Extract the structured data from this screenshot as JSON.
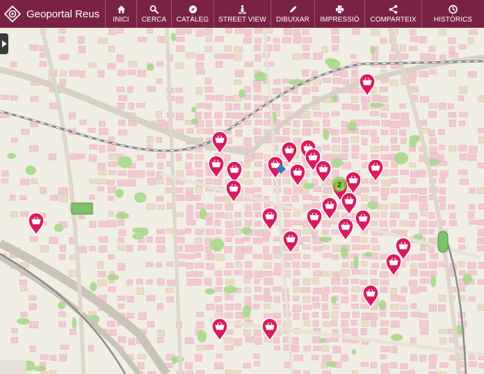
{
  "app": {
    "title": "Geoportal Reus"
  },
  "nav": {
    "items": [
      {
        "label": "INICI",
        "icon": "home-icon"
      },
      {
        "label": "CERCA",
        "icon": "search-icon"
      },
      {
        "label": "CATÀLEG",
        "icon": "compass-icon"
      },
      {
        "label": "STREET VIEW",
        "icon": "pegman-icon"
      },
      {
        "label": "DIBUIXAR",
        "icon": "pencil-icon"
      },
      {
        "label": "IMPRESSIÓ",
        "icon": "printer-icon"
      },
      {
        "label": "COMPARTEIX",
        "icon": "share-icon"
      },
      {
        "label": "HISTÒRICS",
        "icon": "clock-icon"
      }
    ]
  },
  "map": {
    "cluster_count": "2",
    "marker_color": "#d81b60",
    "cluster_color": "#8bc34a"
  },
  "colors": {
    "header": "#7a2244",
    "block": "#f2c9cf",
    "park": "#a8d88a"
  }
}
